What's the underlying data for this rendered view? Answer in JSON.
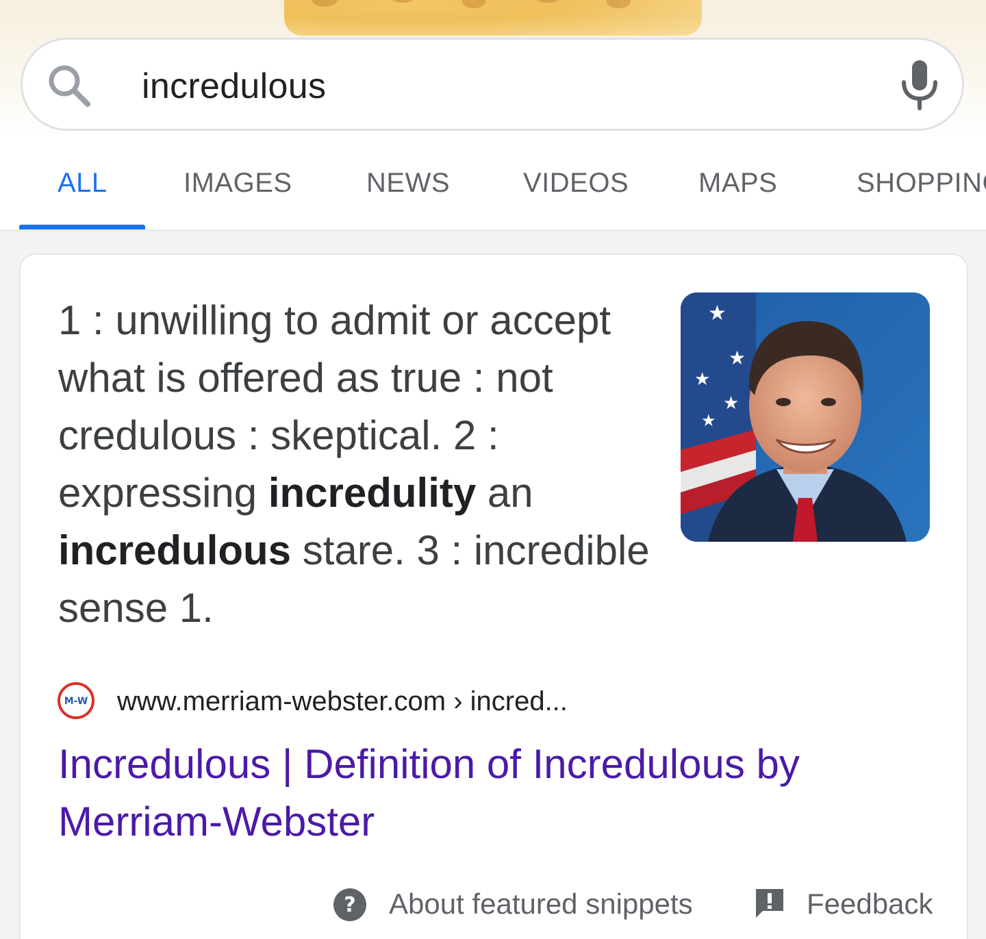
{
  "search": {
    "query": "incredulous"
  },
  "tabs": [
    {
      "label": "ALL",
      "active": true
    },
    {
      "label": "IMAGES",
      "active": false
    },
    {
      "label": "NEWS",
      "active": false
    },
    {
      "label": "VIDEOS",
      "active": false
    },
    {
      "label": "MAPS",
      "active": false
    },
    {
      "label": "SHOPPING",
      "active": false
    }
  ],
  "snippet": {
    "definition": {
      "p1": "1 : unwilling to admit or accept what is offered as true : not credulous : skeptical. 2 : expressing ",
      "b1": "incredulity",
      "p2": " an ",
      "b2": "incredulous",
      "p3": " stare. 3 : incredible sense 1."
    },
    "source": {
      "logo_text": "M-W",
      "url": "www.merriam-webster.com › incred..."
    },
    "result_title": "Incredulous | Definition of Incredulous by Merriam-Webster"
  },
  "footer": {
    "about_label": "About featured snippets",
    "feedback_label": "Feedback"
  },
  "icons": {
    "search": "search-icon",
    "mic": "mic-icon",
    "help": "question-circle-icon",
    "feedback": "feedback-icon"
  },
  "colors": {
    "accent": "#1a73e8",
    "visited_link": "#4b1aa8",
    "muted_text": "#5f6368",
    "body_text": "#3c4043"
  }
}
